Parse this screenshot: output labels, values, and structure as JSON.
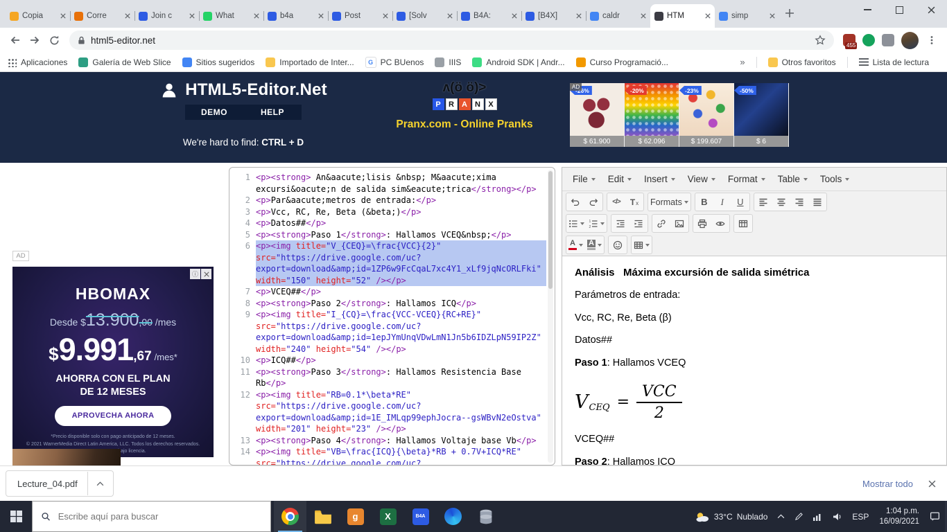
{
  "browser": {
    "tabs": [
      {
        "label": "Copia",
        "color": "#f5a623"
      },
      {
        "label": "Corre",
        "color": "#e8710a"
      },
      {
        "label": "Join c",
        "color": "#2d5be3"
      },
      {
        "label": "What",
        "color": "#25d366"
      },
      {
        "label": "b4a",
        "color": "#2d5be3"
      },
      {
        "label": "Post",
        "color": "#2d5be3"
      },
      {
        "label": "[Solv",
        "color": "#2d5be3"
      },
      {
        "label": "B4A:",
        "color": "#2d5be3"
      },
      {
        "label": "[B4X]",
        "color": "#2d5be3"
      },
      {
        "label": "caldr",
        "color": "#4285f4"
      },
      {
        "label": "HTM",
        "color": "#3c3c44",
        "active": true
      },
      {
        "label": "simp",
        "color": "#4285f4"
      }
    ],
    "url": "html5-editor.net",
    "extension_badge": "455",
    "overflow_chevron": "»",
    "bookmarks_left": [
      {
        "label": "Aplicaciones",
        "icon": "grid"
      },
      {
        "label": "Galería de Web Slice",
        "icon": "gallery"
      },
      {
        "label": "Sitios sugeridos",
        "icon": "blue"
      },
      {
        "label": "Importado de Inter...",
        "icon": "folder"
      },
      {
        "label": "PC BUenos",
        "icon": "g"
      },
      {
        "label": "IIIS",
        "icon": "gray"
      },
      {
        "label": "Android SDK | Andr...",
        "icon": "android"
      },
      {
        "label": "Curso Programació...",
        "icon": "orange"
      }
    ],
    "bookmarks_right": [
      {
        "label": "Otros favoritos",
        "icon": "folder"
      },
      {
        "label": "Lista de lectura",
        "icon": "list"
      }
    ]
  },
  "site_header": {
    "title": "HTML5-Editor.Net",
    "nav": [
      "DEMO",
      "HELP"
    ],
    "tagline_prefix": "We're hard to find: ",
    "tagline_strong": "CTRL + D",
    "pranx": {
      "emoticon": "ʌ(ö ö)>",
      "letters": [
        {
          "ch": "P",
          "bg": "#2757e8",
          "fg": "#ffffff"
        },
        {
          "ch": "R",
          "bg": "#ffffff",
          "fg": "#111111"
        },
        {
          "ch": "A",
          "bg": "#e8542c",
          "fg": "#ffffff"
        },
        {
          "ch": "N",
          "bg": "#ffffff",
          "fg": "#111111"
        },
        {
          "ch": "X",
          "bg": "#ffffff",
          "fg": "#111111"
        }
      ],
      "caption": "Pranx.com - Online Pranks"
    },
    "ad_label": "AD",
    "products": [
      {
        "discount": "-26%",
        "price": "$ 61.900",
        "badge": "#2f62e9",
        "img": "lingerie"
      },
      {
        "discount": "-20%",
        "price": "$ 62.096",
        "badge": "#e43a2e",
        "img": "popit"
      },
      {
        "discount": "-23%",
        "price": "$ 199.607",
        "badge": "#2f62e9",
        "img": "beads"
      },
      {
        "discount": "-50%",
        "price": "$ 6",
        "badge": "#2f62e9",
        "img": "dark"
      }
    ]
  },
  "left_ad": {
    "ad_label": "AD",
    "brand": "HBOMAX",
    "old_prefix": "Desde $",
    "old_main": "13.900",
    "old_cents": ",00",
    "old_per": " /mes",
    "cur": "$",
    "price_main": "9.991",
    "price_cents": ",67",
    "price_per": "/mes*",
    "promo_line1": "AHORRA CON EL PLAN",
    "promo_line2": "DE 12 MESES",
    "cta": "APROVECHA AHORA",
    "fine1": "*Precio disponible solo con pago anticipado de 12 meses.",
    "fine2": "© 2021 WarnerMedia Direct Latin America, LLC. Todos los derechos reservados. HBO Max se usa bajo licencia."
  },
  "code": {
    "lines": [
      {
        "segments": [
          [
            "t",
            "<p><strong>"
          ],
          [
            "x",
            " An&aacute;lisis &nbsp; M&aacute;xima excursi&oacute;n de salida sim&eacute;trica"
          ],
          [
            "t",
            "</strong></p>"
          ]
        ]
      },
      {
        "segments": [
          [
            "t",
            "<p>"
          ],
          [
            "x",
            "Par&aacute;metros de entrada:"
          ],
          [
            "t",
            "</p>"
          ]
        ]
      },
      {
        "segments": [
          [
            "t",
            "<p>"
          ],
          [
            "x",
            "Vcc, RC, Re, Beta (&beta;)"
          ],
          [
            "t",
            "</p>"
          ]
        ]
      },
      {
        "segments": [
          [
            "t",
            "<p>"
          ],
          [
            "x",
            "Datos##"
          ],
          [
            "t",
            "</p>"
          ]
        ]
      },
      {
        "segments": [
          [
            "t",
            "<p><strong>"
          ],
          [
            "x",
            "Paso 1"
          ],
          [
            "t",
            "</strong>"
          ],
          [
            "x",
            ": Hallamos VCEQ&nbsp;"
          ],
          [
            "t",
            "</p>"
          ]
        ]
      },
      {
        "selected": true,
        "segments": [
          [
            "t",
            "<p><img "
          ],
          [
            "a",
            "title="
          ],
          [
            "v",
            "\"V_{CEQ}=\\frac{VCC}{2}\""
          ],
          [
            "x",
            " "
          ],
          [
            "a",
            "src="
          ],
          [
            "v",
            "\"https://drive.google.com/uc?export=download&amp;id=1ZP6w9FcCqaL7xc4Y1_xLf9jqNcORLFki\""
          ],
          [
            "x",
            " "
          ],
          [
            "a",
            "width="
          ],
          [
            "v",
            "\"150\""
          ],
          [
            "x",
            " "
          ],
          [
            "a",
            "height="
          ],
          [
            "v",
            "\"52\""
          ],
          [
            "t",
            " /></p>"
          ]
        ]
      },
      {
        "segments": [
          [
            "t",
            "<p>"
          ],
          [
            "x",
            "VCEQ##"
          ],
          [
            "t",
            "</p>"
          ]
        ]
      },
      {
        "segments": [
          [
            "t",
            "<p><strong>"
          ],
          [
            "x",
            "Paso 2"
          ],
          [
            "t",
            "</strong>"
          ],
          [
            "x",
            ": Hallamos ICQ"
          ],
          [
            "t",
            "</p>"
          ]
        ]
      },
      {
        "segments": [
          [
            "t",
            "<p><img "
          ],
          [
            "a",
            "title="
          ],
          [
            "v",
            "\"I_{CQ}=\\frac{VCC-VCEQ}{RC+RE}\""
          ],
          [
            "x",
            " "
          ],
          [
            "a",
            "src="
          ],
          [
            "v",
            "\"https://drive.google.com/uc?export=download&amp;id=1epJYmUnqVDwLmN1Jn5b6IDZLpN59IP2Z\""
          ],
          [
            "x",
            " "
          ],
          [
            "a",
            "width="
          ],
          [
            "v",
            "\"240\""
          ],
          [
            "x",
            " "
          ],
          [
            "a",
            "height="
          ],
          [
            "v",
            "\"54\""
          ],
          [
            "t",
            " /></p>"
          ]
        ]
      },
      {
        "segments": [
          [
            "t",
            "<p>"
          ],
          [
            "x",
            "ICQ##"
          ],
          [
            "t",
            "</p>"
          ]
        ]
      },
      {
        "segments": [
          [
            "t",
            "<p><strong>"
          ],
          [
            "x",
            "Paso 3"
          ],
          [
            "t",
            "</strong>"
          ],
          [
            "x",
            ": Hallamos Resistencia Base Rb"
          ],
          [
            "t",
            "</p>"
          ]
        ]
      },
      {
        "segments": [
          [
            "t",
            "<p><img "
          ],
          [
            "a",
            "title="
          ],
          [
            "v",
            "\"RB=0.1*\\beta*RE\""
          ],
          [
            "x",
            " "
          ],
          [
            "a",
            "src="
          ],
          [
            "v",
            "\"https://drive.google.com/uc?export=download&amp;id=1E_IMLqp99ephJocra--gsWBvN2eOstva\""
          ],
          [
            "x",
            " "
          ],
          [
            "a",
            "width="
          ],
          [
            "v",
            "\"201\""
          ],
          [
            "x",
            " "
          ],
          [
            "a",
            "height="
          ],
          [
            "v",
            "\"23\""
          ],
          [
            "t",
            " /></p>"
          ]
        ]
      },
      {
        "segments": [
          [
            "t",
            "<p><strong>"
          ],
          [
            "x",
            "Paso 4"
          ],
          [
            "t",
            "</strong>"
          ],
          [
            "x",
            ": Hallamos Voltaje base Vb"
          ],
          [
            "t",
            "</p>"
          ]
        ]
      },
      {
        "segments": [
          [
            "t",
            "<p><img "
          ],
          [
            "a",
            "title="
          ],
          [
            "v",
            "\"VB=\\frac{ICQ}{\\beta}*RB + 0.7V+ICQ*RE\""
          ],
          [
            "x",
            " "
          ],
          [
            "a",
            "src="
          ],
          [
            "v",
            "\"https://drive.google.com/uc?export=download&amp;id=1prs62pisBAnH5E3gE7RTTtzksP9"
          ]
        ]
      }
    ]
  },
  "editor": {
    "menus": [
      "File",
      "Edit",
      "Insert",
      "View",
      "Format",
      "Table",
      "Tools"
    ],
    "toolbar": {
      "formats": "Formats",
      "source_icon": "</>",
      "clear_T": "T",
      "clear_x": "x",
      "bold": "B",
      "italic": "I",
      "underline": "U",
      "forecolor_a": "A",
      "backcolor_a": "A"
    },
    "content": {
      "title": "Análisis   Máxima excursión de salida simétrica",
      "p1": "Parámetros de entrada:",
      "p2": "Vcc, RC, Re, Beta (β)",
      "p3": "Datos##",
      "step1_label": "Paso 1",
      "step1_text": ": Hallamos VCEQ",
      "formula": {
        "lhs": "V",
        "sub": "CEQ",
        "eq": "=",
        "num": "VCC",
        "den": "2"
      },
      "p4": "VCEQ##",
      "step2_label": "Paso 2",
      "step2_text": ": Hallamos ICQ"
    }
  },
  "download_bar": {
    "file": "Lecture_04.pdf",
    "show_all": "Mostrar todo"
  },
  "taskbar": {
    "search_placeholder": "Escribe aquí para buscar",
    "apps": [
      {
        "name": "chrome",
        "active": true
      },
      {
        "name": "explorer"
      },
      {
        "name": "orange-app",
        "letter": "g"
      },
      {
        "name": "excel",
        "letter": "X"
      },
      {
        "name": "b4a",
        "letter": "B4A"
      },
      {
        "name": "edge"
      },
      {
        "name": "db"
      }
    ],
    "weather_temp": "33°C",
    "weather_desc": "Nublado",
    "lang": "ESP",
    "time": "1:04 p.m.",
    "date": "16/09/2021"
  }
}
